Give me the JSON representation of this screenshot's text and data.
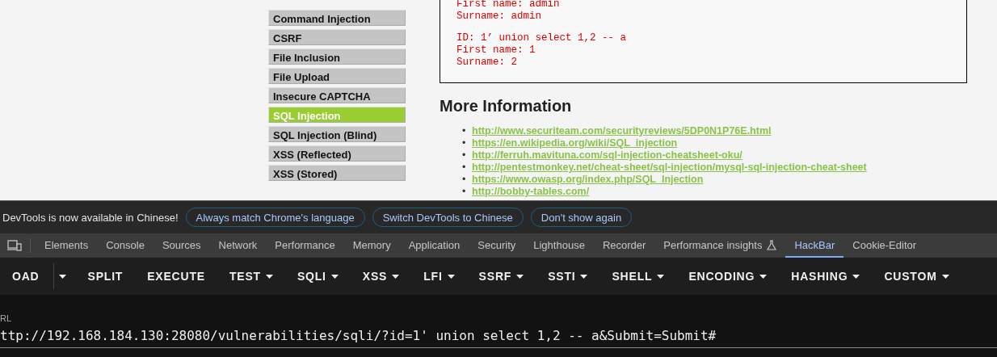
{
  "page": {
    "menu": [
      {
        "label": "Command Injection",
        "selected": false
      },
      {
        "label": "CSRF",
        "selected": false
      },
      {
        "label": "File Inclusion",
        "selected": false
      },
      {
        "label": "File Upload",
        "selected": false
      },
      {
        "label": "Insecure CAPTCHA",
        "selected": false
      },
      {
        "label": "SQL Injection",
        "selected": true
      },
      {
        "label": "SQL Injection (Blind)",
        "selected": false
      },
      {
        "label": "XSS (Reflected)",
        "selected": false
      },
      {
        "label": "XSS (Stored)",
        "selected": false
      }
    ],
    "results": [
      {
        "lines": [
          "First name: admin",
          "Surname: admin"
        ]
      },
      {
        "lines": [
          "ID: 1’ union select 1,2 -- a",
          "First name: 1",
          "Surname: 2"
        ]
      }
    ],
    "more_information": {
      "heading": "More Information",
      "links": [
        {
          "bullet": "•",
          "url": "http://www.securiteam.com/securityreviews/5DP0N1P76E.html"
        },
        {
          "bullet": "•",
          "url": "https://en.wikipedia.org/wiki/SQL_injection"
        },
        {
          "bullet": "•",
          "url": "http://ferruh.mavituna.com/sql-injection-cheatsheet-oku/"
        },
        {
          "bullet": "•",
          "url": "http://pentestmonkey.net/cheat-sheet/sql-injection/mysql-sql-injection-cheat-sheet"
        },
        {
          "bullet": "•",
          "url": "https://www.owasp.org/index.php/SQL_Injection"
        },
        {
          "bullet": "•",
          "url": "http://bobby-tables.com/"
        }
      ]
    }
  },
  "devtools": {
    "infobar": {
      "message": "DevTools is now available in Chinese!",
      "buttons": [
        "Always match Chrome's language",
        "Switch DevTools to Chinese",
        "Don't show again"
      ]
    },
    "tabs": [
      {
        "label": "Elements",
        "selected": false,
        "kind": "plain"
      },
      {
        "label": "Console",
        "selected": false,
        "kind": "plain"
      },
      {
        "label": "Sources",
        "selected": false,
        "kind": "plain"
      },
      {
        "label": "Network",
        "selected": false,
        "kind": "plain"
      },
      {
        "label": "Performance",
        "selected": false,
        "kind": "plain"
      },
      {
        "label": "Memory",
        "selected": false,
        "kind": "plain"
      },
      {
        "label": "Application",
        "selected": false,
        "kind": "plain"
      },
      {
        "label": "Security",
        "selected": false,
        "kind": "plain"
      },
      {
        "label": "Lighthouse",
        "selected": false,
        "kind": "plain"
      },
      {
        "label": "Recorder",
        "selected": false,
        "kind": "plain"
      },
      {
        "label": "Performance insights",
        "selected": false,
        "kind": "experimental"
      },
      {
        "label": "HackBar",
        "selected": true,
        "kind": "plain"
      },
      {
        "label": "Cookie-Editor",
        "selected": false,
        "kind": "plain"
      }
    ],
    "hackbar": {
      "toolbar": [
        {
          "label": "OAD",
          "kind": "split"
        },
        {
          "label": "SPLIT",
          "kind": "plain"
        },
        {
          "label": "EXECUTE",
          "kind": "plain"
        },
        {
          "label": "TEST",
          "kind": "dropdown"
        },
        {
          "label": "SQLI",
          "kind": "dropdown"
        },
        {
          "label": "XSS",
          "kind": "dropdown"
        },
        {
          "label": "LFI",
          "kind": "dropdown"
        },
        {
          "label": "SSRF",
          "kind": "dropdown"
        },
        {
          "label": "SSTI",
          "kind": "dropdown"
        },
        {
          "label": "SHELL",
          "kind": "dropdown"
        },
        {
          "label": "ENCODING",
          "kind": "dropdown"
        },
        {
          "label": "HASHING",
          "kind": "dropdown"
        },
        {
          "label": "CUSTOM",
          "kind": "dropdown"
        }
      ],
      "url": {
        "label": "RL",
        "value": "ttp://192.168.184.130:28080/vulnerabilities/sqli/?id=1' union select 1,2 -- a&Submit=Submit#"
      }
    }
  }
}
